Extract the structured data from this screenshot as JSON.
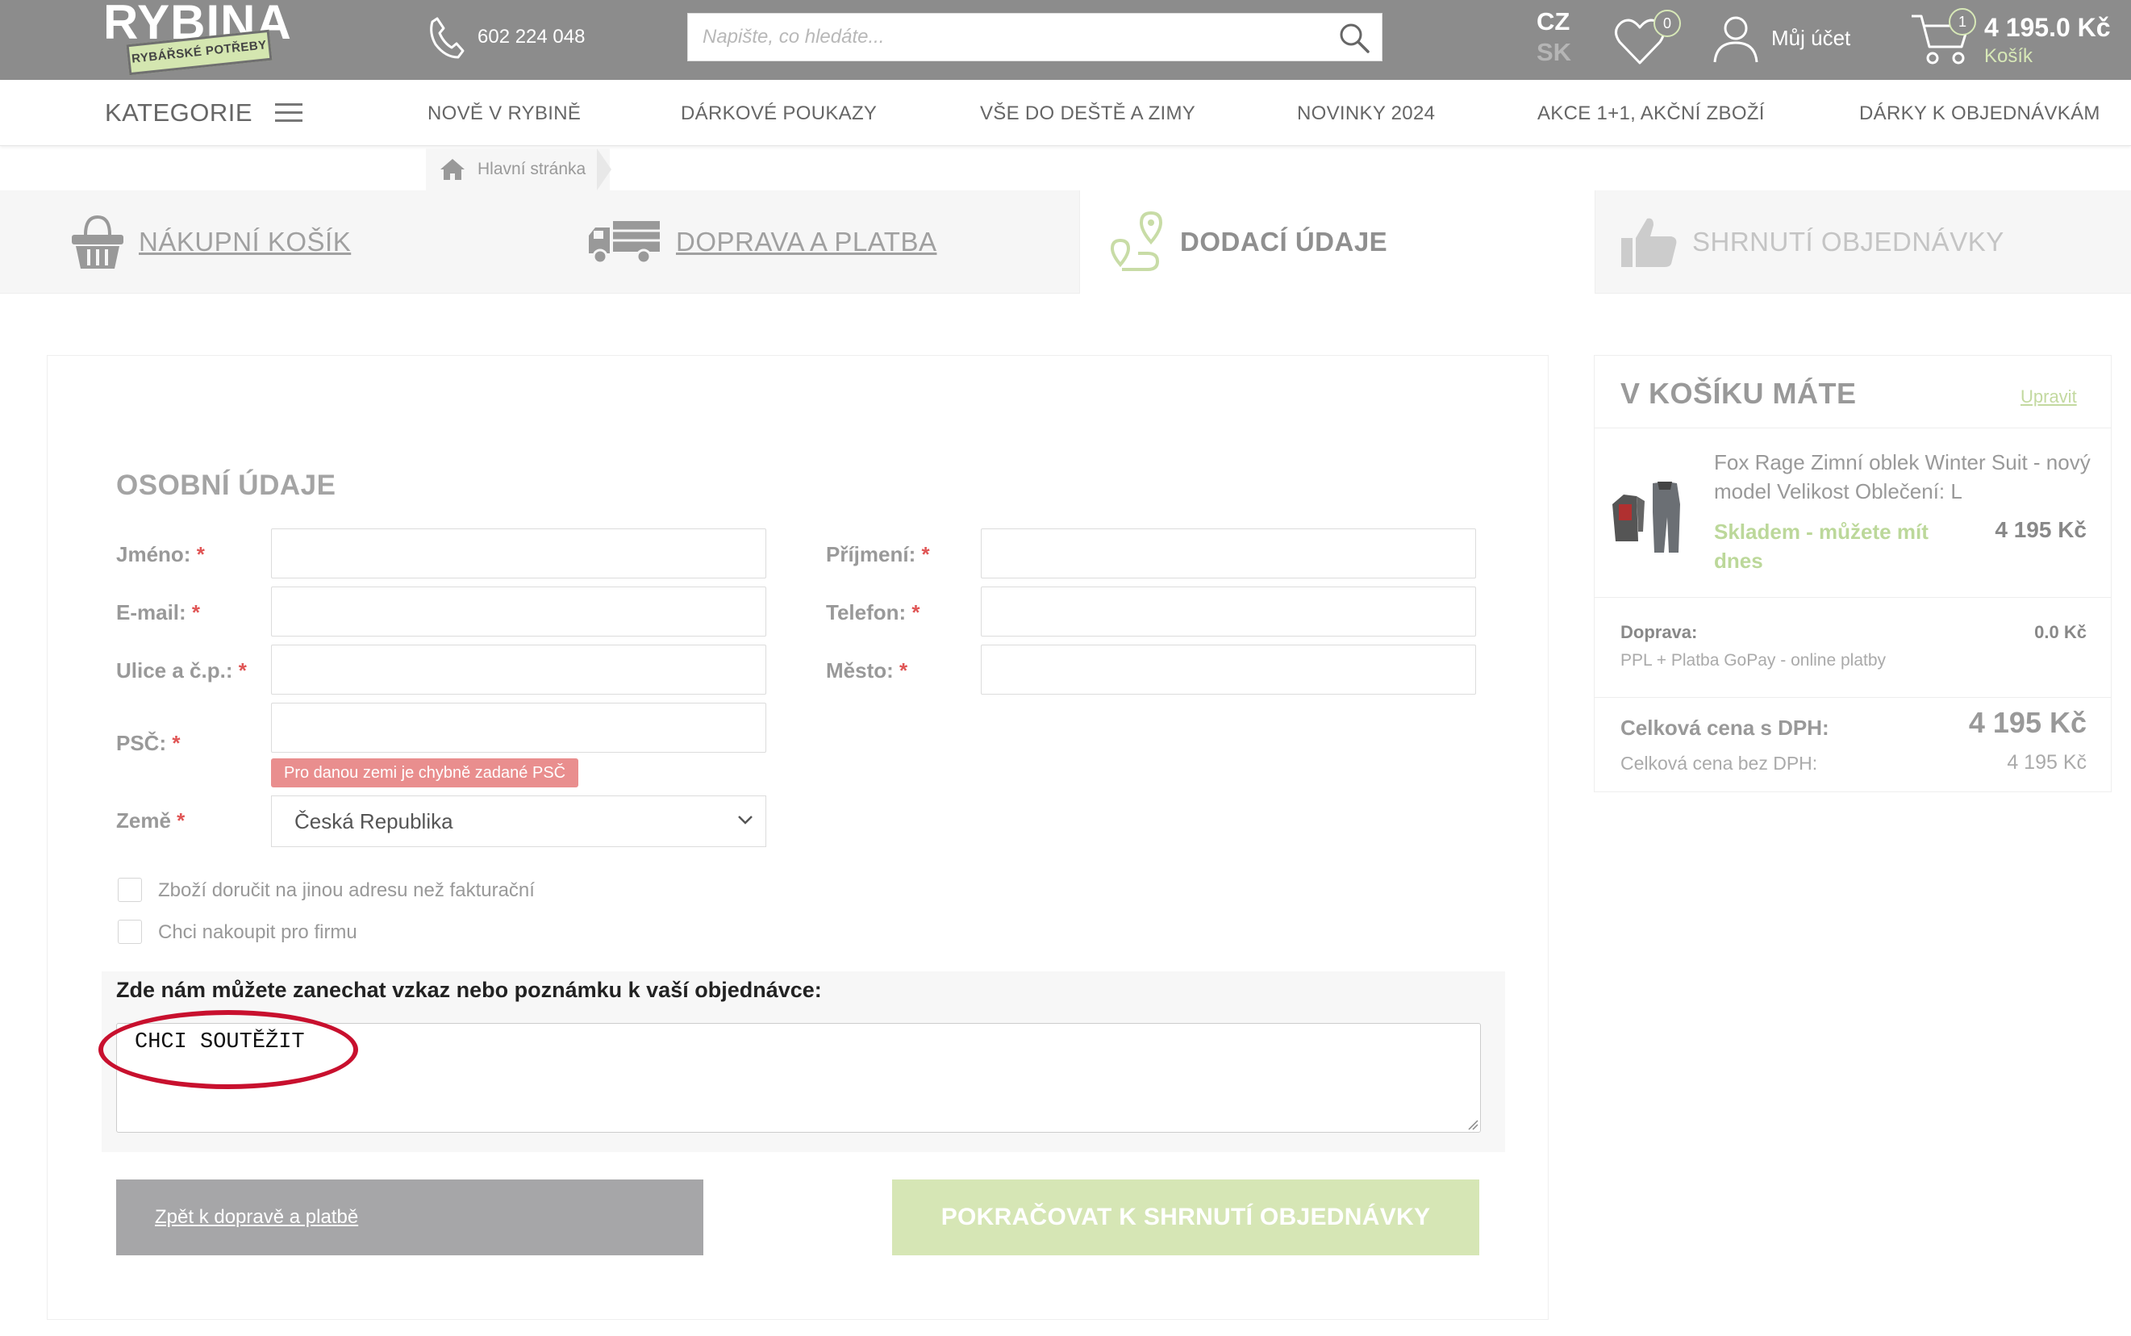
{
  "header": {
    "logo_text": "RYBINA",
    "logo_tagline": "RYBÁŘSKÉ POTŘEBY",
    "phone": "602 224 048",
    "search_placeholder": "Napište, co hledáte...",
    "lang_cz": "CZ",
    "lang_sk": "SK",
    "wishlist_count": "0",
    "account_label": "Můj účet",
    "cart_count": "1",
    "cart_price": "4 195.0 Kč",
    "cart_label": "Košík"
  },
  "nav": {
    "categories_label": "KATEGORIE",
    "items": [
      "NOVĚ V RYBINĚ",
      "DÁRKOVÉ POUKAZY",
      "VŠE DO DEŠTĚ A ZIMY",
      "NOVINKY 2024",
      "AKCE 1+1, AKČNÍ ZBOŽÍ",
      "DÁRKY K OBJEDNÁVKÁM"
    ]
  },
  "breadcrumb": {
    "home": "Hlavní stránka"
  },
  "steps": {
    "cart": "NÁKUPNÍ KOŠÍK",
    "shipping": "DOPRAVA A PLATBA",
    "delivery": "DODACÍ ÚDAJE",
    "summary": "SHRNUTÍ OBJEDNÁVKY"
  },
  "form": {
    "section_title": "OSOBNÍ ÚDAJE",
    "required_mark": "*",
    "first_name_label": "Jméno:",
    "first_name_value": "",
    "last_name_label": "Příjmení:",
    "last_name_value": "",
    "email_label": "E-mail:",
    "email_value": "",
    "phone_label": "Telefon:",
    "phone_value": "",
    "street_label": "Ulice a č.p.:",
    "street_value": "",
    "city_label": "Město:",
    "city_value": "",
    "zip_label": "PSČ:",
    "zip_value": "",
    "zip_error": "Pro danou zemi je chybně zadané PSČ",
    "country_label": "Země",
    "country_value": "Česká Republika",
    "checkbox_other_address": "Zboží doručit na jinou adresu než fakturační",
    "checkbox_company": "Chci nakoupit pro firmu",
    "note_label": "Zde nám můžete zanechat vzkaz nebo poznámku k vaší objednávce:",
    "note_value": "CHCI SOUTĚŽIT",
    "back_button": "Zpět k dopravě a platbě",
    "next_button": "POKRAČOVAT K SHRNUTÍ OBJEDNÁVKY"
  },
  "summary": {
    "title": "V KOŠÍKU MÁTE",
    "edit_link": "Upravit",
    "product_name": "Fox Rage Zimní oblek Winter Suit - nový model Velikost Oblečení: L",
    "product_stock": "Skladem - můžete mít dnes",
    "product_price": "4 195 Kč",
    "shipping_label": "Doprava:",
    "shipping_value": "0.0 Kč",
    "shipping_desc": "PPL  + Platba GoPay - online platby",
    "total_label": "Celková cena s DPH:",
    "total_value": "4 195 Kč",
    "total_novat_label": "Celková cena bez DPH:",
    "total_novat_value": "4 195 Kč"
  },
  "colors": {
    "header_bg": "#8c8c8c",
    "accent_green": "#d6e6b5",
    "error_red": "#e98e8e",
    "highlight_ellipse": "#c8102e"
  }
}
